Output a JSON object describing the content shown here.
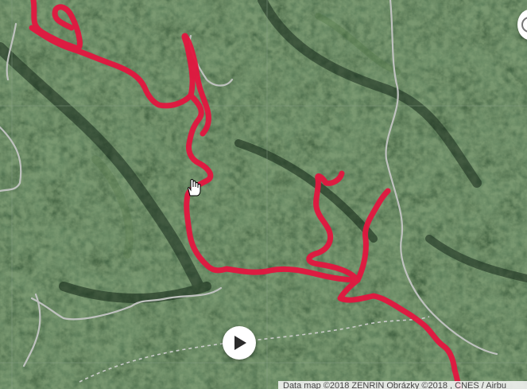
{
  "map": {
    "type": "satellite",
    "colors": {
      "track": "#e3163f",
      "road": "#bfc2bf",
      "forest_dark": "#16301b",
      "forest_mid": "#2a4a2c",
      "forest_light": "#3e6438",
      "grid": "#8aa08a"
    },
    "attribution": "Data map ©2018 ZENRIN Obrázky ©2018 , CNES / Airbu"
  },
  "controls": {
    "play_icon": "play-icon",
    "cursor_icon": "hand-pointer-icon",
    "side_control_icon": "map-control-icon"
  }
}
